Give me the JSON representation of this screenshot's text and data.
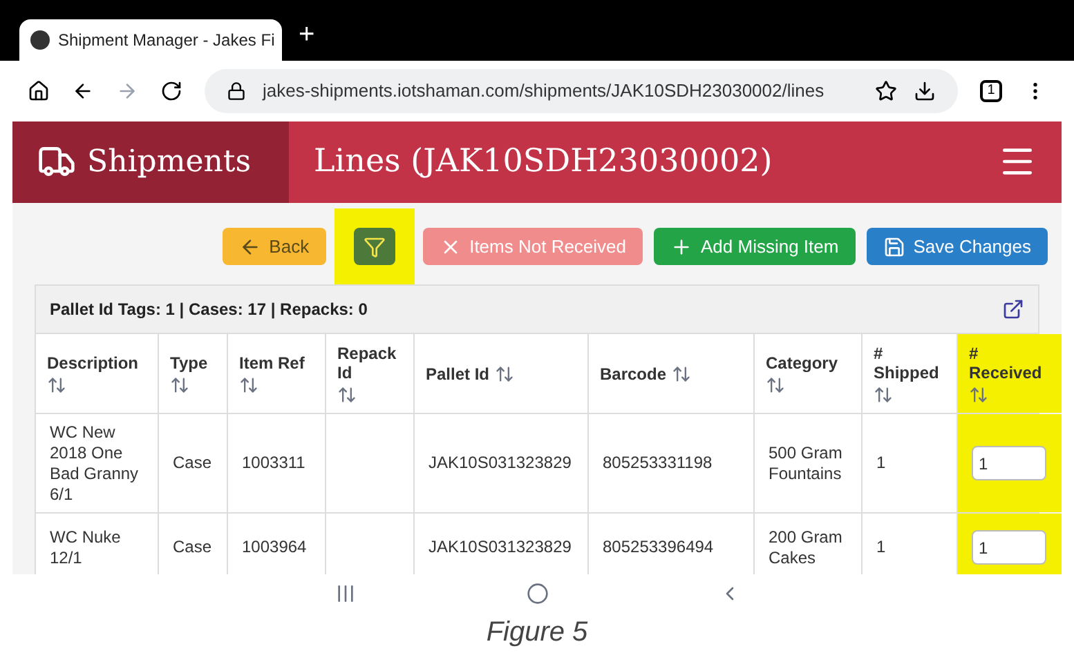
{
  "browser": {
    "tab_title": "Shipment Manager - Jakes Fi",
    "new_tab": "+",
    "url": "jakes-shipments.iotshaman.com/shipments/JAK10SDH23030002/lines",
    "tab_count": "1"
  },
  "header": {
    "brand": "Shipments",
    "title": "Lines (JAK10SDH23030002)"
  },
  "toolbar": [
    {
      "kind": "back",
      "label": "Back",
      "highlighted": false
    },
    {
      "kind": "filter",
      "highlighted": true
    },
    {
      "kind": "not-received",
      "label": "Items Not Received",
      "highlighted": false
    },
    {
      "kind": "add",
      "label": "Add Missing Item",
      "highlighted": false
    },
    {
      "kind": "save",
      "label": "Save Changes",
      "highlighted": false
    }
  ],
  "summary": "Pallet Id Tags: 1 | Cases: 17 | Repacks: 0",
  "table": {
    "columns": [
      {
        "label": "Description",
        "highlighted": false
      },
      {
        "label": "Type",
        "highlighted": false
      },
      {
        "label": "Item Ref",
        "highlighted": false
      },
      {
        "label": "Repack Id",
        "highlighted": false
      },
      {
        "label": "Pallet Id",
        "highlighted": false
      },
      {
        "label": "Barcode",
        "highlighted": false
      },
      {
        "label": "Category",
        "highlighted": false
      },
      {
        "label": "# Shipped",
        "highlighted": false
      },
      {
        "label": "# Received",
        "highlighted": true
      }
    ],
    "rows": [
      [
        "WC New 2018 One Bad Granny 6/1",
        "Case",
        "1003311",
        "",
        "JAK10S031323829",
        "805253331198",
        "500 Gram Fountains",
        "1",
        "1"
      ],
      [
        "WC Nuke 12/1",
        "Case",
        "1003964",
        "",
        "JAK10S031323829",
        "805253396494",
        "200 Gram Cakes",
        "1",
        "1"
      ]
    ]
  },
  "caption": "Figure 5"
}
